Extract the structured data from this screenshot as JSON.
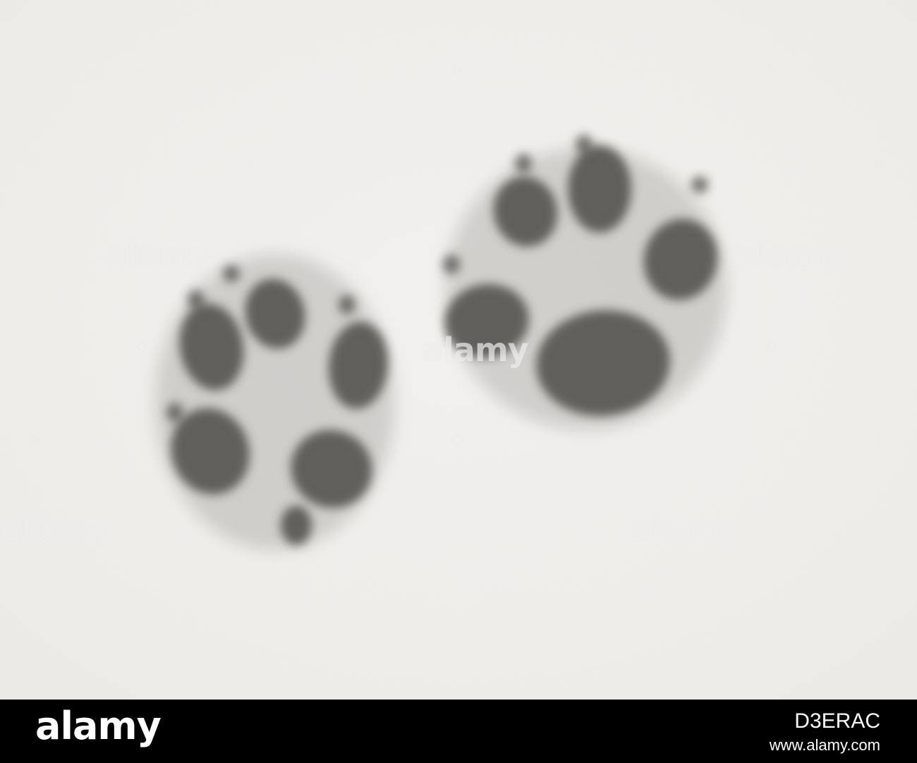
{
  "watermark": {
    "text": "alamy",
    "diamond": "◇"
  },
  "footer": {
    "logo": "alamy",
    "image_id": "D3ERAC",
    "url": "www.alamy.com"
  },
  "colors": {
    "snow": "#f3f1ee",
    "track": "#4a4744",
    "footer": "#000000"
  }
}
